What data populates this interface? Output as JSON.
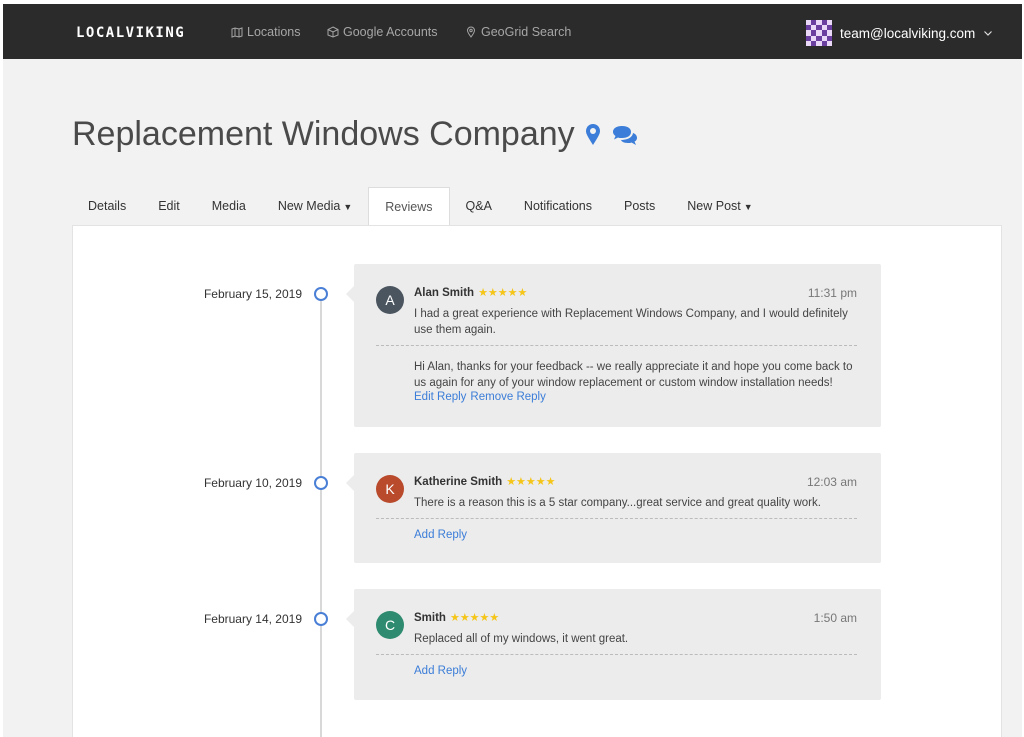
{
  "nav": {
    "logo": "LOCALVIKING",
    "items": [
      {
        "label": "Locations",
        "icon": "map-icon"
      },
      {
        "label": "Google Accounts",
        "icon": "cube-icon"
      },
      {
        "label": "GeoGrid Search",
        "icon": "pin-icon"
      }
    ],
    "user_email": "team@localviking.com"
  },
  "page": {
    "title": "Replacement Windows Company",
    "icons": [
      "map-marker-icon",
      "comments-icon"
    ],
    "accent_color": "#3b7dd8"
  },
  "tabs": [
    {
      "label": "Details"
    },
    {
      "label": "Edit"
    },
    {
      "label": "Media"
    },
    {
      "label": "New Media",
      "dropdown": true
    },
    {
      "label": "Reviews",
      "active": true
    },
    {
      "label": "Q&A"
    },
    {
      "label": "Notifications"
    },
    {
      "label": "Posts"
    },
    {
      "label": "New Post",
      "dropdown": true
    }
  ],
  "reviews": [
    {
      "date": "February 15, 2019",
      "initial": "A",
      "avatar_color": "#4b5560",
      "name": "Alan Smith",
      "stars": "★★★★★",
      "time": "11:31 pm",
      "text": "I had a great experience with Replacement Windows Company, and I would definitely use them again.",
      "reply": "Hi Alan, thanks for your feedback -- we really appreciate it and hope you come back to us again for any of your window replacement or custom window installation needs!",
      "link1": "Edit Reply",
      "link2": "Remove Reply"
    },
    {
      "date": "February 10, 2019",
      "initial": "K",
      "avatar_color": "#b94a2c",
      "name": "Katherine Smith",
      "stars": "★★★★★",
      "time": "12:03 am",
      "text": "There is a reason this is a 5 star company...great service and great quality work.",
      "link1": "Add Reply"
    },
    {
      "date": "February 14, 2019",
      "initial": "C",
      "avatar_color": "#2e8b6f",
      "name": "Smith",
      "stars": "★★★★★",
      "time": "1:50 am",
      "text": "Replaced all of my windows, it went great.",
      "link1": "Add Reply"
    }
  ]
}
